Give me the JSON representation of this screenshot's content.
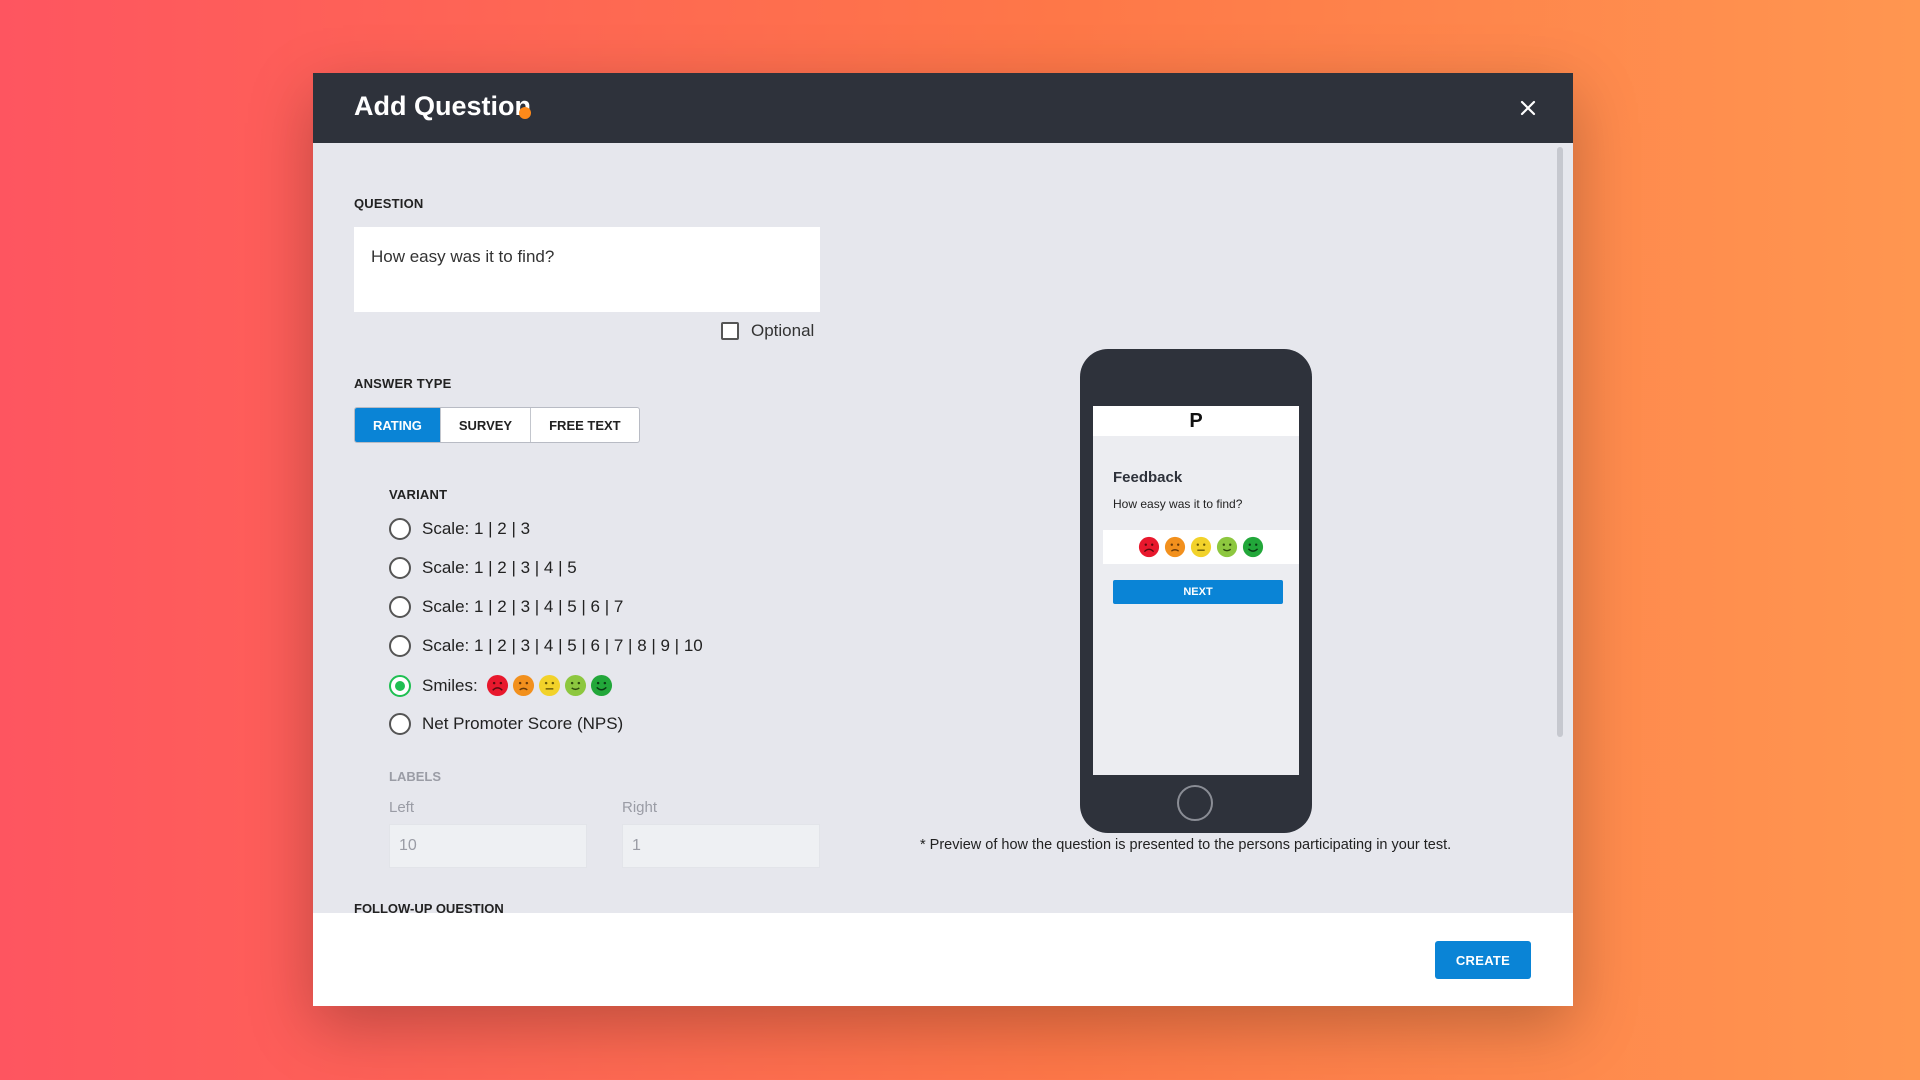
{
  "modal": {
    "title": "Add Question",
    "close_label": "×"
  },
  "question": {
    "section_label": "QUESTION",
    "value": "How easy was it to find?",
    "optional_label": "Optional",
    "optional_checked": false
  },
  "answer_type": {
    "section_label": "ANSWER TYPE",
    "tabs": [
      {
        "label": "RATING",
        "active": true
      },
      {
        "label": "SURVEY",
        "active": false
      },
      {
        "label": "FREE TEXT",
        "active": false
      }
    ]
  },
  "variant": {
    "section_label": "VARIANT",
    "options": [
      {
        "label": "Scale: 1 | 2 | 3",
        "checked": false
      },
      {
        "label": "Scale: 1 | 2 | 3 | 4 | 5",
        "checked": false
      },
      {
        "label": "Scale: 1 | 2 | 3 | 4 | 5 | 6 | 7",
        "checked": false
      },
      {
        "label": "Scale: 1 | 2 | 3 | 4 | 5 | 6 | 7 | 8 | 9 | 10",
        "checked": false
      },
      {
        "label": "Smiles:",
        "checked": true
      },
      {
        "label": "Net Promoter Score (NPS)",
        "checked": false
      }
    ],
    "smile_colors": [
      "#e8182d",
      "#f2901d",
      "#f2d22a",
      "#8dc73f",
      "#22a73a"
    ]
  },
  "labels": {
    "section_label": "LABELS",
    "left_caption": "Left",
    "left_value": "10",
    "right_caption": "Right",
    "right_value": "1"
  },
  "followup": {
    "section_label": "FOLLOW-UP QUESTION"
  },
  "footer": {
    "create_label": "CREATE"
  },
  "preview": {
    "logo": "P",
    "feedback_title": "Feedback",
    "question": "How easy was it to find?",
    "next_label": "NEXT",
    "note": "* Preview of how the question is presented to the persons participating in your test."
  },
  "colors": {
    "accent": "#0a84d6",
    "header_bg": "#2e323b",
    "radio_checked": "#1fbf52",
    "brand_dot": "#ff8a1a"
  }
}
